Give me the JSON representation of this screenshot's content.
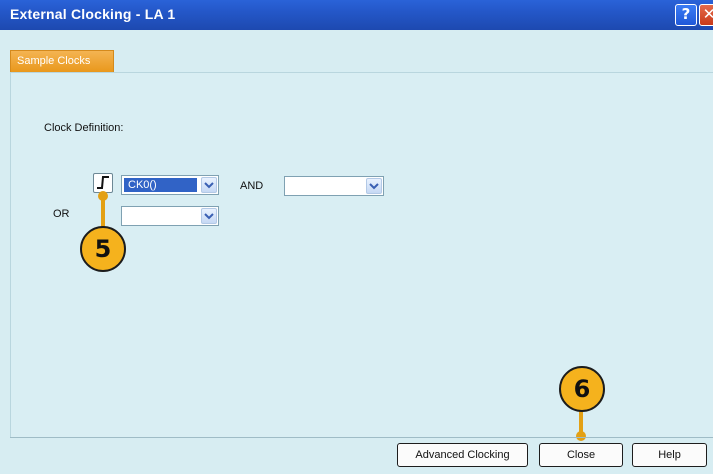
{
  "window": {
    "title": "External Clocking - LA 1",
    "help_glyph": "?",
    "close_glyph": "✕"
  },
  "tabs": [
    {
      "label": "Sample Clocks",
      "active": true
    }
  ],
  "form": {
    "clock_definition_label": "Clock Definition:",
    "edge_icon": "rising-edge-icon",
    "clock_select_value": "CK0()",
    "and_label": "AND",
    "and_select_value": "",
    "or_label": "OR",
    "or_select_value": ""
  },
  "buttons": {
    "advanced_clocking": "Advanced Clocking",
    "close": "Close",
    "help": "Help"
  },
  "callouts": [
    {
      "number": "5"
    },
    {
      "number": "6"
    }
  ],
  "colors": {
    "title_bar": "#2457c8",
    "background": "#d9eef3",
    "tab": "#e9981c",
    "callout": "#f5b21d",
    "selection": "#3163c6"
  }
}
